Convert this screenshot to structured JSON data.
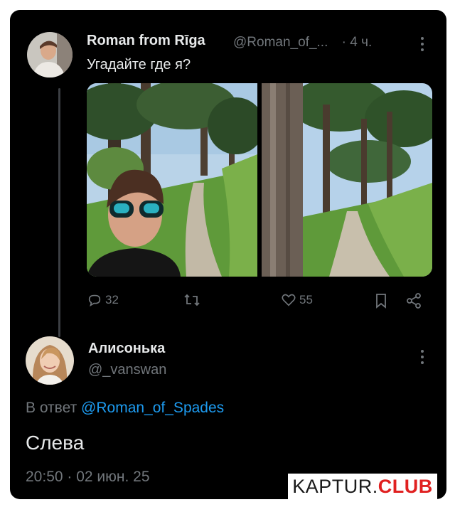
{
  "tweet": {
    "author_name": "Roman from Rīga",
    "handle": "@Roman_of_...",
    "separator": "·",
    "time_ago": "4 ч.",
    "text": "Угадайте где я?",
    "icons": {
      "reply": "comment-icon",
      "retweet": "retweet-icon",
      "like": "heart-icon",
      "bookmark": "bookmark-icon",
      "share": "share-icon",
      "more": "more-vertical-icon"
    },
    "stats": {
      "replies": "32",
      "likes": "55"
    }
  },
  "reply": {
    "author_name": "Алисонька",
    "handle": "@_vanswan",
    "reply_prefix": "В ответ",
    "reply_to": "@Roman_of_Spades",
    "text": "Слева",
    "timestamp": "20:50 · 02 июн. 25"
  },
  "watermark": {
    "part1": "KAPTUR.",
    "part2": "CLUB"
  },
  "colors": {
    "background": "#000000",
    "text": "#e7e9ea",
    "muted": "#71767b",
    "accent": "#1d9bf0",
    "watermark_accent": "#e02020"
  }
}
